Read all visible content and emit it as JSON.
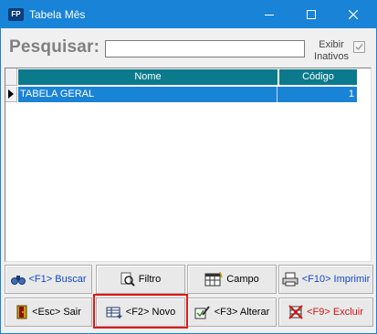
{
  "window": {
    "title": "Tabela Mês",
    "app_badge": "FP"
  },
  "search": {
    "label": "Pesquisar:",
    "value": "",
    "inativos_label": "Exibir Inativos",
    "inativos_checked": true
  },
  "grid": {
    "columns": [
      "Nome",
      "Código"
    ],
    "rows": [
      {
        "nome": "TABELA GERAL",
        "codigo": "1"
      }
    ]
  },
  "buttons": {
    "buscar": "<F1> Buscar",
    "filtro": "Filtro",
    "campo": "Campo",
    "imprimir": "<F10> Imprimir",
    "sair": "<Esc> Sair",
    "novo": "<F2> Novo",
    "alterar": "<F3> Alterar",
    "excluir": "<F9> Excluir"
  },
  "colors": {
    "titlebar": "#1883d7",
    "grid_header": "#0a7a8c",
    "selected_row": "#1983d6",
    "highlight_border": "#e01818"
  }
}
